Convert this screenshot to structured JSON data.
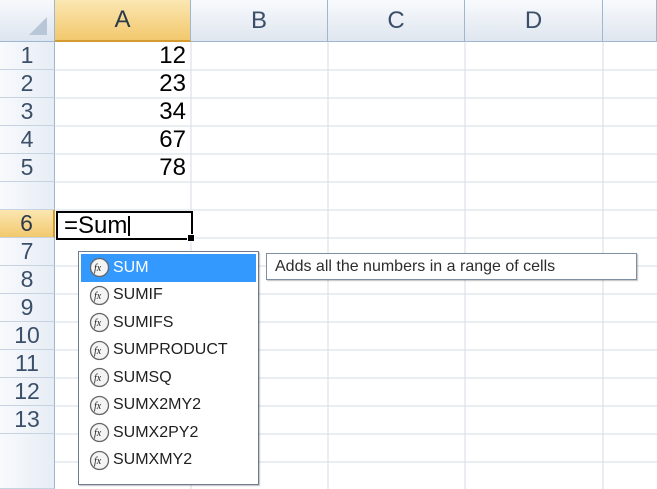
{
  "sheet": {
    "columns": [
      "A",
      "B",
      "C",
      "D"
    ],
    "active_column": "A",
    "rows": [
      "1",
      "2",
      "3",
      "4",
      "5",
      "6",
      "7",
      "8",
      "9",
      "10",
      "11",
      "12",
      "13"
    ],
    "active_row": "6",
    "cells": {
      "a1": "12",
      "a2": "23",
      "a3": "34",
      "a4": "67",
      "a5": "78"
    }
  },
  "editor": {
    "formula_text": "=Sum"
  },
  "autocomplete": {
    "icon_name": "function-icon",
    "selected": "SUM",
    "items": [
      "SUM",
      "SUMIF",
      "SUMIFS",
      "SUMPRODUCT",
      "SUMSQ",
      "SUMX2MY2",
      "SUMX2PY2",
      "SUMXMY2"
    ]
  },
  "tooltip": {
    "text": "Adds all the numbers in a range of cells"
  },
  "colors": {
    "header_bg": "#dfe6ef",
    "header_active": "#f2c86d",
    "selection": "#3399ff",
    "grid_line": "#d8dee7"
  }
}
